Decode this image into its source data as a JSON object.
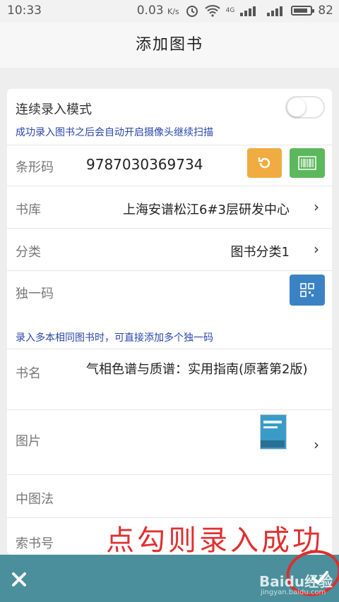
{
  "status": {
    "time": "10:33",
    "speed": "0.03",
    "speed_unit": "K/s",
    "network": "4G",
    "battery": "82"
  },
  "header": {
    "title": "添加图书"
  },
  "form": {
    "continuous": {
      "label": "连续录入模式",
      "hint": "成功录入图书之后会自动开启摄像头继续扫描",
      "enabled": false
    },
    "barcode": {
      "label": "条形码",
      "value": "9787030369734",
      "reset_color": "#f0ac40",
      "scan_color": "#5cb85c"
    },
    "library": {
      "label": "书库",
      "value": "上海安谱松江6#3层研发中心"
    },
    "category": {
      "label": "分类",
      "value": "图书分类1"
    },
    "unique_code": {
      "label": "独一码",
      "hint": "录入多本相同图书时，可直接添加多个独一码",
      "qr_color": "#3b82c4"
    },
    "book_name": {
      "label": "书名",
      "value": "气相色谱与质谱：实用指南(原著第2版)"
    },
    "image": {
      "label": "图片"
    },
    "clc": {
      "label": "中图法"
    },
    "call_no": {
      "label": "索书号"
    }
  },
  "bottom_bar": {
    "color": "#4a8f9b"
  },
  "annotation": {
    "text": "点勾则录入成功"
  },
  "watermark": {
    "text": "Baidu经验",
    "url": "jingyan.baidu.com"
  }
}
